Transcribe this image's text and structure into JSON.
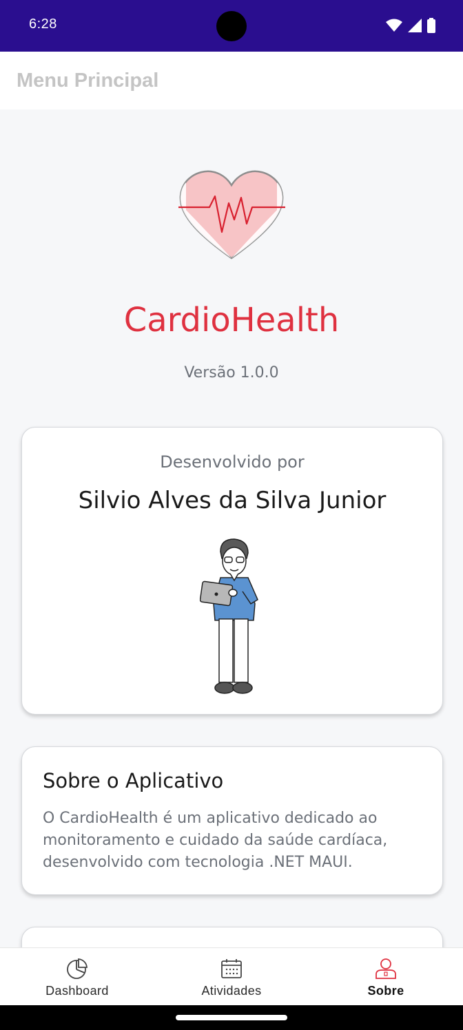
{
  "status_bar": {
    "time": "6:28"
  },
  "app_bar": {
    "title": "Menu Principal"
  },
  "about_page": {
    "app_name": "CardioHealth",
    "version": "Versão 1.0.0",
    "developer_card": {
      "label": "Desenvolvido por",
      "name": "Silvio Alves da Silva Junior"
    },
    "about_card": {
      "title": "Sobre o Aplicativo",
      "text": "O CardioHealth é um aplicativo dedicado ao monitoramento e cuidado da saúde cardíaca, desenvolvido com tecnologia .NET MAUI."
    }
  },
  "bottom_nav": {
    "items": [
      {
        "label": "Dashboard",
        "icon": "pie-chart-icon"
      },
      {
        "label": "Atividades",
        "icon": "calendar-icon"
      },
      {
        "label": "Sobre",
        "icon": "person-icon",
        "active": true
      }
    ]
  },
  "colors": {
    "status_bar": "#2a0e8f",
    "accent": "#df3140",
    "heart_fill": "#f7c4c6",
    "text_muted": "#6b7078"
  }
}
